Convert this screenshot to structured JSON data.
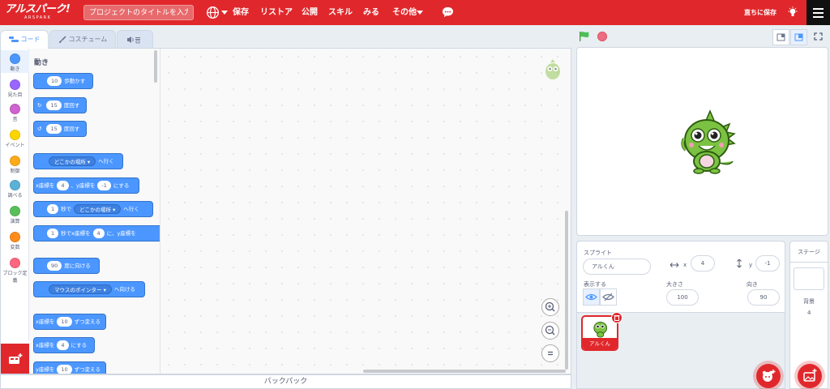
{
  "topbar": {
    "logo_text": "アルスパーク!",
    "logo_sub": "ARSPARK",
    "title_placeholder": "プロジェクトのタイトルを入力",
    "menu": {
      "save": "保存",
      "restore": "リストア",
      "publish": "公開",
      "skill": "スキル",
      "watch": "みる",
      "other": "その他"
    },
    "save_now": "直ちに保存",
    "brand_color": "#e0282c"
  },
  "tabs": {
    "code": "コード",
    "costume": "コスチューム"
  },
  "categories": [
    {
      "label": "動き",
      "color": "#4c97ff"
    },
    {
      "label": "見た目",
      "color": "#9966ff"
    },
    {
      "label": "音",
      "color": "#cf63cf"
    },
    {
      "label": "イベント",
      "color": "#ffd500"
    },
    {
      "label": "制御",
      "color": "#ffab19"
    },
    {
      "label": "調べる",
      "color": "#5cb1d6"
    },
    {
      "label": "演算",
      "color": "#59c059"
    },
    {
      "label": "変数",
      "color": "#ff8c1a"
    },
    {
      "label": "ブロック定義",
      "color": "#ff6680"
    }
  ],
  "palette": {
    "title": "動き",
    "move": {
      "val": "10",
      "text": "歩動かす"
    },
    "turn_right": {
      "val": "15",
      "text": "度回す"
    },
    "turn_left": {
      "val": "15",
      "text": "度回す"
    },
    "goto": {
      "dd": "どこかの場所",
      "text": "へ行く"
    },
    "setxy": {
      "t1": "x座標を",
      "v1": "4",
      "t2": "、y座標を",
      "v2": "-1",
      "t3": "にする"
    },
    "glide": {
      "v1": "1",
      "t1": "秒で",
      "dd": "どこかの場所",
      "t2": "へ行く"
    },
    "glidexy": {
      "v1": "1",
      "t1": "秒でx座標を",
      "v2": "4",
      "t2": "に、y座標を"
    },
    "point": {
      "val": "90",
      "text": "度に向ける"
    },
    "pointto": {
      "dd": "マウスのポインター",
      "text": "へ向ける"
    },
    "changex": {
      "t1": "x座標を",
      "val": "10",
      "t2": "ずつ変える"
    },
    "setx": {
      "t1": "x座標を",
      "val": "4",
      "t2": "にする"
    },
    "changey": {
      "t1": "y座標を",
      "val": "10",
      "t2": "ずつ変える"
    },
    "block_color": "#4c97ff"
  },
  "backpack": "バックパック",
  "sprite_info": {
    "label": "スプライト",
    "name": "アルくん",
    "x_label": "x",
    "x": "4",
    "y_label": "y",
    "y": "-1",
    "show_label": "表示する",
    "size_label": "大きさ",
    "size": "100",
    "direction_label": "向き",
    "direction": "90"
  },
  "sprites": [
    {
      "name": "アルくん"
    }
  ],
  "stage_pane": {
    "title": "ステージ",
    "backdrops_label": "背景",
    "backdrops_count": "4"
  }
}
